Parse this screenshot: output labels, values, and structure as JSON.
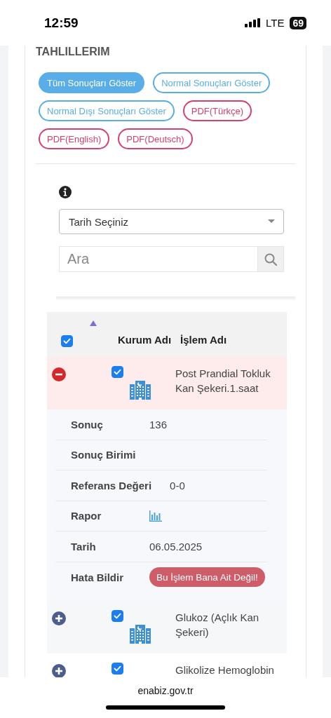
{
  "status_bar": {
    "time": "12:59",
    "network": "LTE",
    "battery": "69"
  },
  "section_title": "TAHLILLERIM",
  "filters": [
    {
      "label": "Tüm Sonuçları Göster",
      "kind": "filter",
      "selected": true
    },
    {
      "label": "Normal Sonuçları Göster",
      "kind": "filter",
      "selected": false
    },
    {
      "label": "Normal Dışı Sonuçları Göster",
      "kind": "filter",
      "selected": false
    },
    {
      "label": "PDF(Türkçe)",
      "kind": "pdf",
      "selected": false
    },
    {
      "label": "PDF(English)",
      "kind": "pdf",
      "selected": false
    },
    {
      "label": "PDF(Deutsch)",
      "kind": "pdf",
      "selected": false
    }
  ],
  "date_select": {
    "placeholder": "Tarih Seçiniz"
  },
  "search": {
    "placeholder": "Ara"
  },
  "table": {
    "select_all": {
      "checked": true
    },
    "columns": [
      "Kurum Adı",
      "İşlem Adı"
    ],
    "rows": [
      {
        "name": "Post Prandial Tokluk Kan Şekeri.1.saat",
        "expanded": true,
        "checked": true,
        "institution_icon": true,
        "details": [
          {
            "label": "Sonuç",
            "kind": "text",
            "value": "136"
          },
          {
            "label": "Sonuç Birimi",
            "kind": "text"
          },
          {
            "label": "Referans Değeri",
            "kind": "text",
            "value": "0-0"
          },
          {
            "label": "Rapor",
            "kind": "chart"
          },
          {
            "label": "Tarih",
            "kind": "text",
            "value": "06.05.2025"
          },
          {
            "label": "Hata Bildir",
            "kind": "button",
            "value": "Bu İşlem Bana Ait Değil!"
          }
        ]
      },
      {
        "name": "Glukoz (Açlık Kan Şekeri)",
        "expanded": false,
        "checked": true,
        "institution_icon": true
      },
      {
        "name": "Glikolize Hemoglobin",
        "expanded": false,
        "checked": true
      }
    ]
  },
  "browser_bar": {
    "url": "enabiz.gov.tr"
  }
}
